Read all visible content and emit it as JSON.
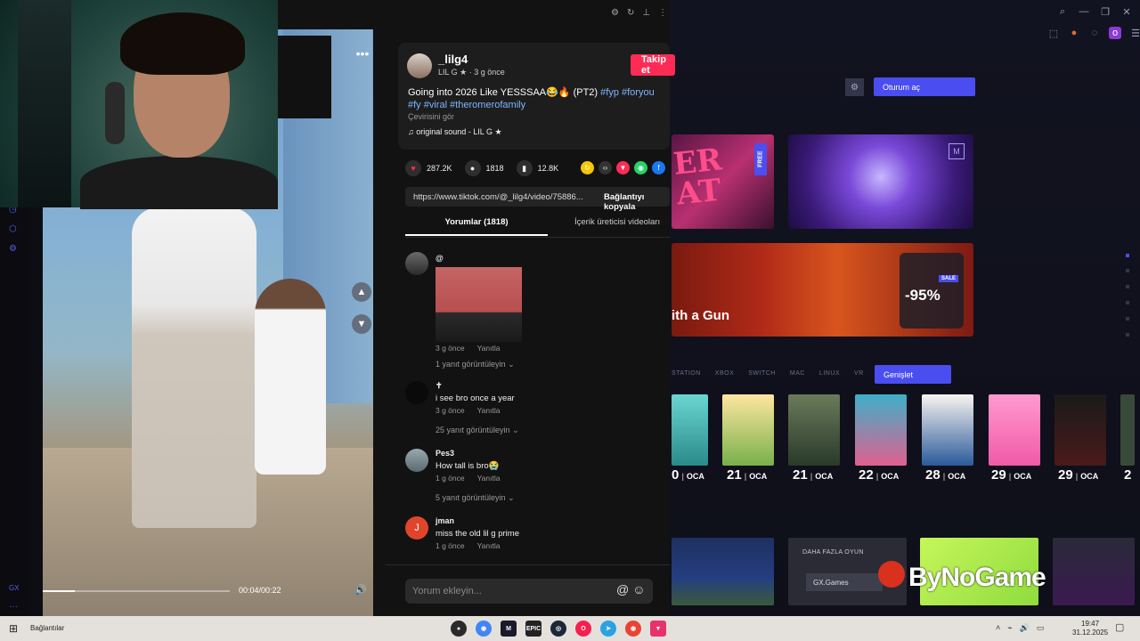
{
  "tiktok": {
    "username": "_lilg4",
    "display_name": "LIL G ★",
    "posted": "3 g önce",
    "follow_label": "Takip et",
    "caption_text": "Going into 2026 Like YESSSAA😂🔥 (PT2) ",
    "caption_tags": [
      "#fyp",
      "#foryou",
      "#fy",
      "#viral",
      "#theromerofamily"
    ],
    "translate_label": "Çevirisini gör",
    "sound": "original sound - LIL G ★",
    "likes": "287.2K",
    "comments_count": "1818",
    "saves": "12.8K",
    "link": "https://www.tiktok.com/@_lilg4/video/75886...",
    "copy_link_label": "Bağlantıyı kopyala",
    "tab_comments": "Yorumlar (1818)",
    "tab_creator": "İçerik üreticisi videoları",
    "comment_placeholder": "Yorum ekleyin...",
    "comments": [
      {
        "name": "",
        "text": "@",
        "time": "3 g önce",
        "reply_label": "Yanıtla",
        "replies": "1 yanıt görüntüleyin",
        "avatar_color": "#3a3a3a"
      },
      {
        "name": "✝",
        "text": "i see bro once a year",
        "time": "3 g önce",
        "reply_label": "Yanıtla",
        "replies": "25 yanıt görüntüleyin",
        "avatar_color": "#0a0a0a"
      },
      {
        "name": "Pes3",
        "text": "How tall is bro😭",
        "time": "1 g önce",
        "reply_label": "Yanıtla",
        "replies": "5 yanıt görüntüleyin",
        "avatar_color": "#7a8a90"
      },
      {
        "name": "jman",
        "text": "miss the old lil g prime",
        "time": "1 g önce",
        "reply_label": "Yanıtla",
        "replies": "",
        "avatar_color": "#e0452b"
      }
    ],
    "comment4_initial": "J"
  },
  "video": {
    "timecode": "00:04/00:22",
    "progress_fraction": 0.17
  },
  "gx": {
    "login_label": "Oturum aç",
    "banner1_badge": "FREE",
    "banner3_title": "ith a Gun",
    "sale_tag": "SALE",
    "sale_pct": "-95%",
    "platforms": [
      "STATION",
      "XBOX",
      "SWITCH",
      "MAC",
      "LINUX",
      "VR"
    ],
    "expand_label": "Genişlet",
    "dates": [
      {
        "day": "0",
        "mon": "OCA"
      },
      {
        "day": "21",
        "mon": "OCA"
      },
      {
        "day": "21",
        "mon": "OCA"
      },
      {
        "day": "22",
        "mon": "OCA"
      },
      {
        "day": "28",
        "mon": "OCA"
      },
      {
        "day": "29",
        "mon": "OCA"
      },
      {
        "day": "29",
        "mon": "OCA"
      },
      {
        "day": "2",
        "mon": ""
      }
    ],
    "more_games_label": "DAHA FAZLA OYUN",
    "gx_games_label": "GX.Games",
    "watermark": "ByNoGame"
  },
  "taskbar": {
    "label": "Bağlantılar",
    "time": "19:47",
    "date": "31.12.2025"
  }
}
